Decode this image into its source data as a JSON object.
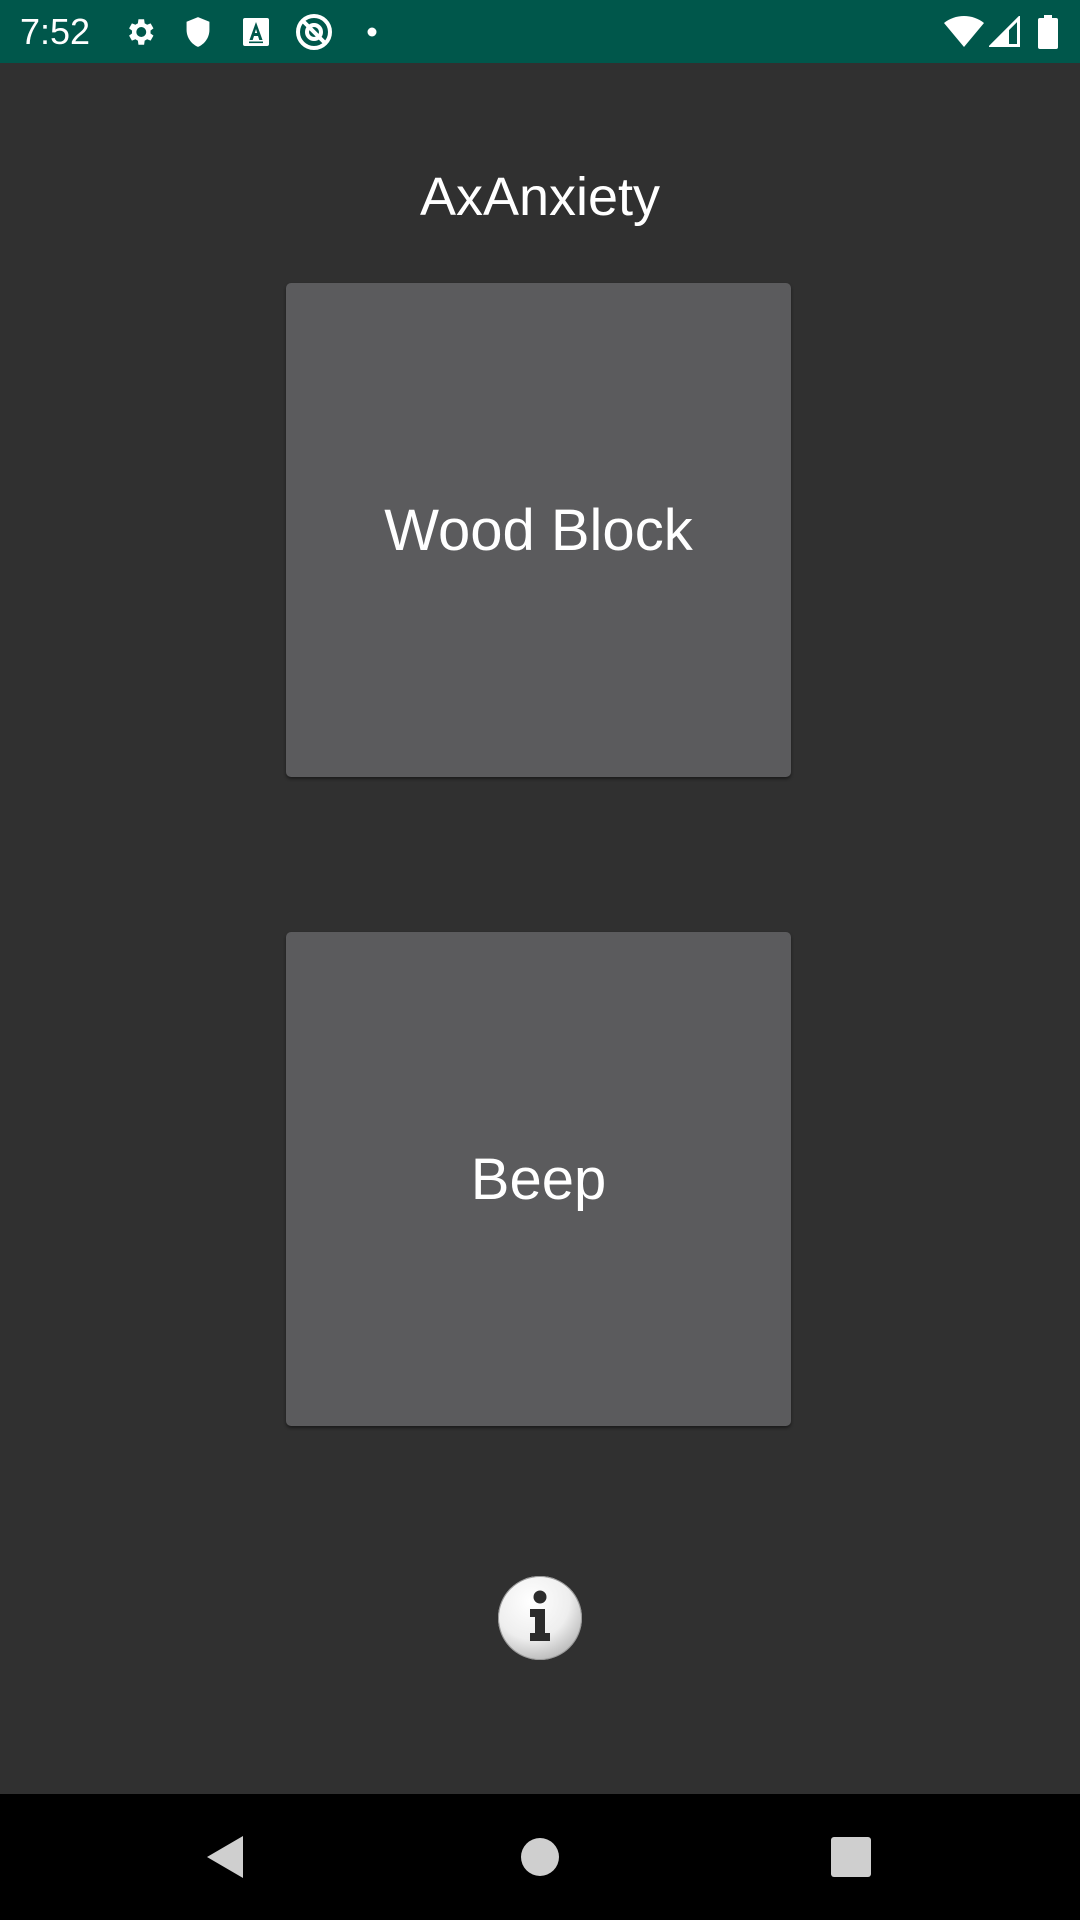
{
  "status_bar": {
    "time": "7:52",
    "background": "#00574B",
    "left_icons": [
      "settings-icon",
      "shield-icon",
      "font-a-icon",
      "no-data-icon",
      "notification-dot-icon"
    ],
    "right_icons": [
      "wifi-icon",
      "cell-signal-icon",
      "battery-icon"
    ]
  },
  "app": {
    "title": "AxAnxiety",
    "background": "#303030"
  },
  "buttons": {
    "wood_block_label": "Wood Block",
    "beep_label": "Beep",
    "button_color": "#5B5B5D"
  },
  "info": {
    "icon": "info-icon"
  },
  "nav_bar": {
    "back": "back-triangle-icon",
    "home": "home-circle-icon",
    "recents": "recents-square-icon"
  }
}
